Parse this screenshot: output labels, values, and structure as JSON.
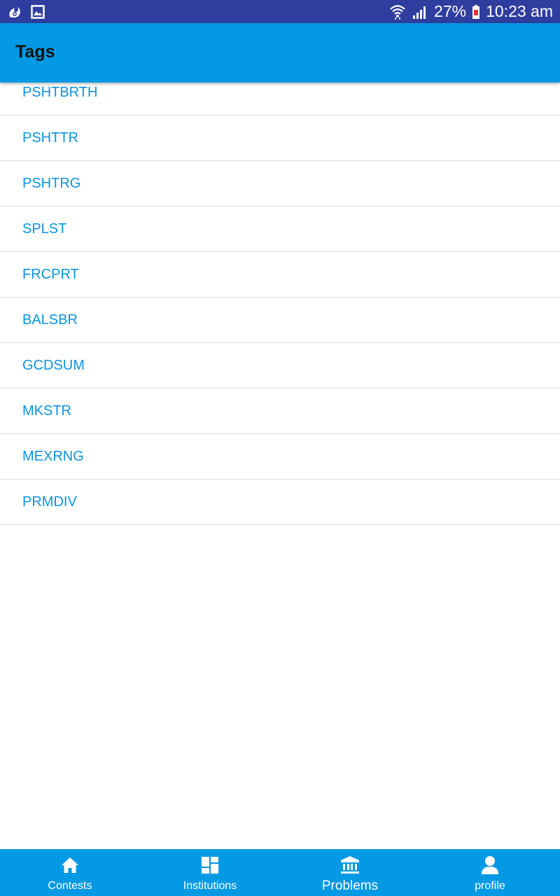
{
  "status_bar": {
    "left_icons": [
      "uc-browser-icon",
      "image-icon"
    ],
    "right_icons": [
      "wifi-icon",
      "signal-icon",
      "battery-icon"
    ],
    "battery_percent": "27%",
    "time": "10:23 am"
  },
  "app_bar": {
    "title": "Tags"
  },
  "tags": [
    "PSHTBRTH",
    "PSHTTR",
    "PSHTRG",
    "SPLST",
    "FRCPRT",
    "BALSBR",
    "GCDSUM",
    "MKSTR",
    "MEXRNG",
    "PRMDIV"
  ],
  "bottom_nav": {
    "items": [
      {
        "label": "Contests",
        "icon": "home-icon",
        "active": false
      },
      {
        "label": "Institutions",
        "icon": "dashboard-icon",
        "active": false
      },
      {
        "label": "Problems",
        "icon": "bank-icon",
        "active": true
      },
      {
        "label": "profile",
        "icon": "person-icon",
        "active": false
      }
    ]
  },
  "colors": {
    "status_bar": "#2f3d9e",
    "primary": "#0399e4",
    "tag_text": "#0b95df",
    "divider": "#dcdcdc"
  }
}
